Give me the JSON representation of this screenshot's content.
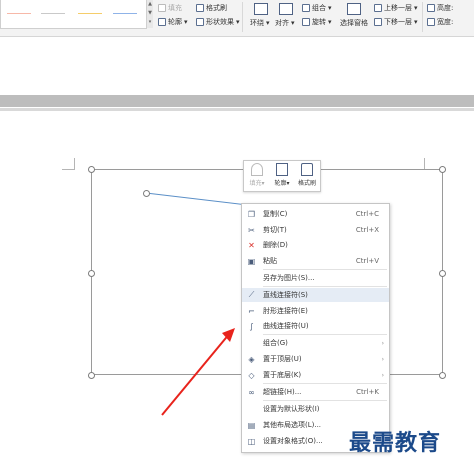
{
  "ribbon": {
    "fill_label": "填充",
    "format_painter_label": "格式刷",
    "outline_label": "轮廓",
    "shape_effect_label": "形状效果",
    "wrap_label": "环绕",
    "align_label": "对齐",
    "group_label": "组合",
    "rotate_label": "旋转",
    "selection_pane_label": "选择窗格",
    "bring_forward_label": "上移一层",
    "send_backward_label": "下移一层",
    "height_label": "高度:",
    "width_label": "宽度:",
    "line_colors": [
      "#f7b8a8",
      "#c9c9c9",
      "#f5cd6a",
      "#8fb3e8"
    ]
  },
  "mini_toolbar": {
    "fill_label": "填充",
    "outline_label": "轮廓",
    "painter_label": "格式刷"
  },
  "context_menu": {
    "items": [
      {
        "icon": "copy-icon",
        "label": "复制(C)",
        "shortcut": "Ctrl+C"
      },
      {
        "icon": "cut-icon",
        "label": "剪切(T)",
        "shortcut": "Ctrl+X"
      },
      {
        "icon": "delete-icon",
        "label": "删除(D)",
        "shortcut": ""
      },
      {
        "icon": "paste-icon",
        "label": "粘贴",
        "shortcut": "Ctrl+V"
      },
      {
        "icon": "",
        "label": "另存为图片(S)...",
        "shortcut": ""
      },
      {
        "icon": "straight-connector-icon",
        "label": "直线连接符(S)",
        "shortcut": ""
      },
      {
        "icon": "elbow-connector-icon",
        "label": "肘形连接符(E)",
        "shortcut": ""
      },
      {
        "icon": "curved-connector-icon",
        "label": "曲线连接符(U)",
        "shortcut": ""
      },
      {
        "icon": "",
        "label": "组合(G)",
        "shortcut": ""
      },
      {
        "icon": "bring-to-front-icon",
        "label": "置于顶层(U)",
        "shortcut": ""
      },
      {
        "icon": "send-to-back-icon",
        "label": "置于底层(K)",
        "shortcut": ""
      },
      {
        "icon": "hyperlink-icon",
        "label": "超链接(H)...",
        "shortcut": "Ctrl+K"
      },
      {
        "icon": "",
        "label": "设置为默认形状(I)",
        "shortcut": ""
      },
      {
        "icon": "layout-options-icon",
        "label": "其他布局选项(L)...",
        "shortcut": ""
      },
      {
        "icon": "format-object-icon",
        "label": "设置对象格式(O)...",
        "shortcut": ""
      }
    ]
  },
  "watermark": "最需教育",
  "colors": {
    "arrow": "#e8231c",
    "connector": "#5b8fc7",
    "menu_highlight": "#e5ecf5",
    "watermark": "#1c4a8a"
  }
}
